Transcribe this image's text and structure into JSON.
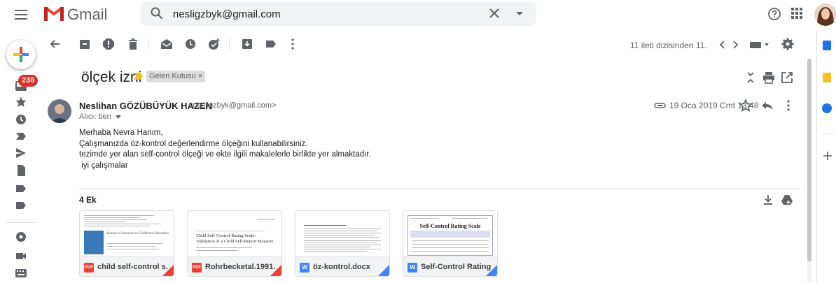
{
  "header": {
    "app_name": "Gmail",
    "search_value": "nesligzbyk@gmail.com",
    "icons": [
      "menu-icon",
      "gmail-logo",
      "search-icon",
      "close-icon",
      "chevron-down-icon",
      "help-icon",
      "apps-icon",
      "avatar"
    ]
  },
  "rail": {
    "inbox_count": "238",
    "icons": [
      "compose-icon",
      "inbox-icon",
      "star-icon",
      "clock-icon",
      "label-important-icon",
      "send-icon",
      "draft-icon",
      "label-icon",
      "label-icon",
      "chevron-down-icon",
      "hangouts-icon",
      "video-icon",
      "keyboard-icon"
    ]
  },
  "toolbar": {
    "pager_text": "11 ileti dizisinden 11.",
    "icons": [
      "back-arrow-icon",
      "archive-icon",
      "report-spam-icon",
      "delete-icon",
      "mark-unread-icon",
      "snooze-icon",
      "add-to-tasks-icon",
      "move-to-icon",
      "label-icon",
      "more-vert-icon",
      "chevron-left-icon",
      "chevron-right-icon",
      "keyboard-icon",
      "settings-icon"
    ]
  },
  "thread": {
    "subject": "ölçek izni",
    "label": "Gelen Kutusu ×",
    "icons": [
      "importance-icon",
      "collapse-icon",
      "print-icon",
      "open-in-new-icon"
    ]
  },
  "message": {
    "sender_name": "Neslihan GÖZÜBÜYÜK HAZEN",
    "sender_email": "<nesligzbyk@gmail.com>",
    "recipient": "Alıcı: ben",
    "date": "19 Oca 2019 Cmt 13:48",
    "body": [
      "Merhaba Nevra Hanım,",
      "Çalışmanızda öz-kontrol değerlendirme ölçeğini kullanabilirsiniz.",
      "tezimde yer alan self-control ölçeği ve ekte ilgili makalelerle birlikte yer almaktadır.",
      " iyi çalışmalar"
    ],
    "icons": [
      "attachment-icon",
      "star-icon",
      "reply-icon",
      "more-vert-icon"
    ]
  },
  "attachments": {
    "count_label": "4 Ek",
    "items": [
      {
        "type": "PDF",
        "name": "child self-control s...",
        "color": "#e94235"
      },
      {
        "type": "PDF",
        "name": "Rohrbecketal.1991...",
        "color": "#e94235"
      },
      {
        "type": "W",
        "name": "öz-kontrol.docx",
        "color": "#4285f4"
      },
      {
        "type": "W",
        "name": "Self-Control Rating...",
        "color": "#4285f4"
      }
    ],
    "thumb2_title": "Child Self-Control Rating Scale: Validation of a Child Self-Report Measure",
    "thumb4_title": "Self-Control Rating Scale",
    "thumb1_title": "Journal of Research in Childhood Education",
    "icons": [
      "download-icon",
      "save-to-drive-icon"
    ]
  },
  "colors": {
    "accent_red": "#d93025",
    "icon_grey": "#5f6368",
    "label_chip_bg": "#dddddd",
    "importance_yellow": "#f6bf26"
  }
}
